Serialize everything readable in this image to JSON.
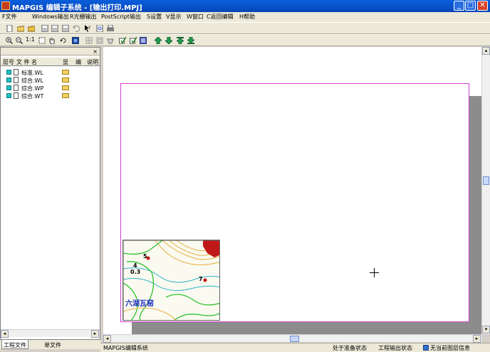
{
  "window": {
    "title": "MAPGIS 编辑子系统 - [输出打印.MPJ]",
    "minimize": "_",
    "maximize": "□",
    "close": "✕"
  },
  "menu": [
    "F文件",
    "Windows输出",
    "R光栅输出",
    "PostScript输出",
    "S设置",
    "V显示",
    "W窗口",
    "C返回编辑",
    "H帮助"
  ],
  "toolbar": {
    "zoom_label": "1:1"
  },
  "panel": {
    "close_glyph": "×",
    "columns": [
      "层号",
      "文 件 名",
      "显",
      "编",
      "说明"
    ],
    "files": [
      {
        "name": "标准.WL"
      },
      {
        "name": "综合.WL"
      },
      {
        "name": "综合.WP"
      },
      {
        "name": "综合.WT"
      }
    ],
    "tabs": [
      "工程文件",
      "单文件"
    ]
  },
  "map": {
    "labels": [
      "5",
      "4",
      "0.3",
      "7",
      "六湖瓦窑"
    ]
  },
  "statusbar": {
    "app_name": "MAPGIS编辑系统",
    "state": "处于准备状态",
    "mode": "工程输出状态",
    "info": "无当前图层信息"
  },
  "colors": {
    "title_blue": "#0845b8",
    "frame_magenta": "#d040d0",
    "layer_cyan": "#20c0c0",
    "contour_green": "#30c030",
    "contour_cyan": "#30b0c8",
    "contour_orange": "#e8b040",
    "map_red": "#c01818",
    "label_blue": "#2030c0"
  }
}
